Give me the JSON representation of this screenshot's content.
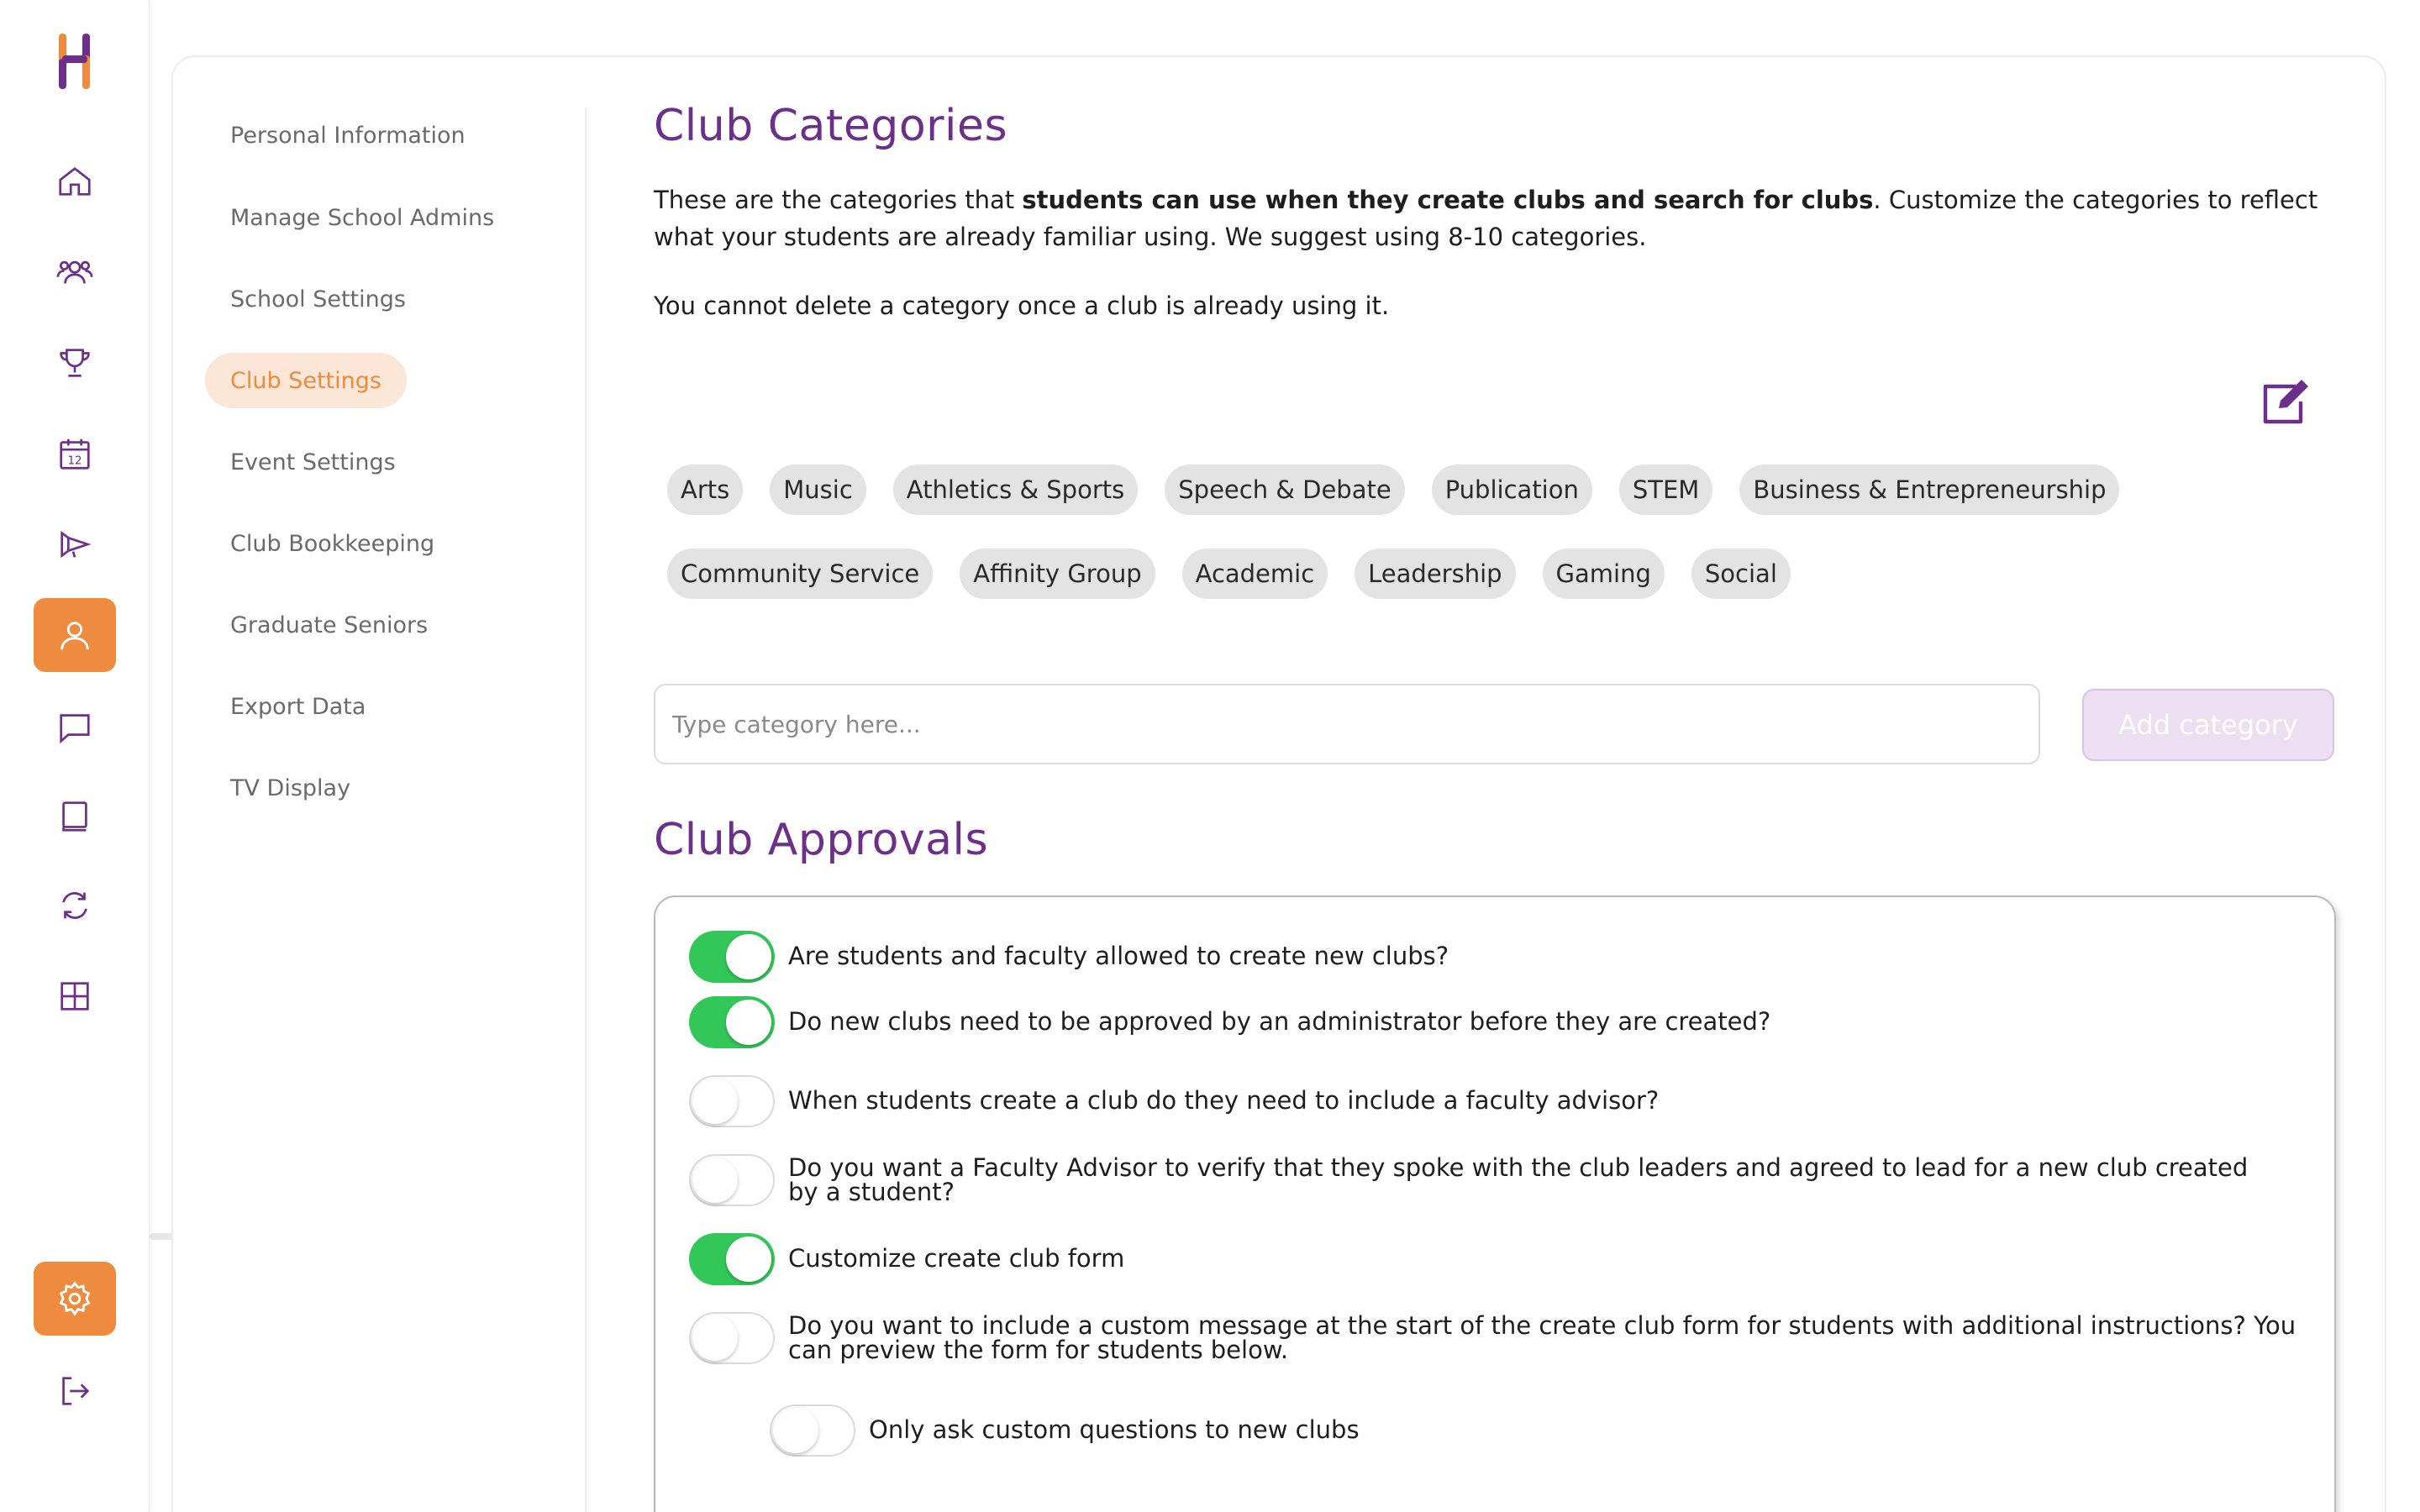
{
  "sidebar_icons": [
    {
      "name": "home-icon"
    },
    {
      "name": "users-icon"
    },
    {
      "name": "trophy-icon"
    },
    {
      "name": "calendar-icon",
      "label": "12"
    },
    {
      "name": "megaphone-icon"
    },
    {
      "name": "profile-icon",
      "active": true
    },
    {
      "name": "chat-icon"
    },
    {
      "name": "book-icon"
    },
    {
      "name": "sync-icon"
    },
    {
      "name": "grid-icon"
    },
    {
      "name": "settings-icon",
      "active": true
    },
    {
      "name": "logout-icon"
    }
  ],
  "colors": {
    "accent_orange": "#ee8b3f",
    "brand_purple": "#6c2f8a",
    "toggle_on": "#33c759",
    "chip_bg": "#e3e3e3"
  },
  "submenu": {
    "items": [
      "Personal Information",
      "Manage School Admins",
      "School Settings",
      "Club Settings",
      "Event Settings",
      "Club Bookkeeping",
      "Graduate Seniors",
      "Export Data",
      "TV Display"
    ],
    "active": "Club Settings"
  },
  "categories": {
    "title": "Club Categories",
    "intro_before": "These are the categories that ",
    "intro_bold": "students can use when they create clubs and search for clubs",
    "intro_after": ". Customize the categories to reflect what your students are already familiar using. We suggest using 8-10 categories.",
    "note": "You cannot delete a category once a club is already using it.",
    "chips_row1": [
      "Arts",
      "Music",
      "Athletics & Sports",
      "Speech & Debate",
      "Publication",
      "STEM",
      "Business & Entrepreneurship"
    ],
    "chips_row2": [
      "Community Service",
      "Affinity Group",
      "Academic",
      "Leadership",
      "Gaming",
      "Social"
    ],
    "input_placeholder": "Type category here...",
    "add_button": "Add category"
  },
  "approvals": {
    "title": "Club Approvals",
    "toggles": [
      {
        "label": "Are students and faculty allowed to create new clubs?",
        "on": true
      },
      {
        "label": "Do new clubs need to be approved by an administrator before they are created?",
        "on": true
      },
      {
        "label": "When students create a club do they need to include a faculty advisor?",
        "on": false
      },
      {
        "label": "Do you want a Faculty Advisor to verify that they spoke with the club leaders and agreed to lead for a new club created by a student?",
        "on": false
      },
      {
        "label": "Customize create club form",
        "on": true
      },
      {
        "label": "Do you want to include a custom message at the start of the create club form for students with additional instructions? You can preview the form for students below.",
        "on": false
      },
      {
        "label": "Only ask custom questions to new clubs",
        "on": false
      }
    ]
  }
}
